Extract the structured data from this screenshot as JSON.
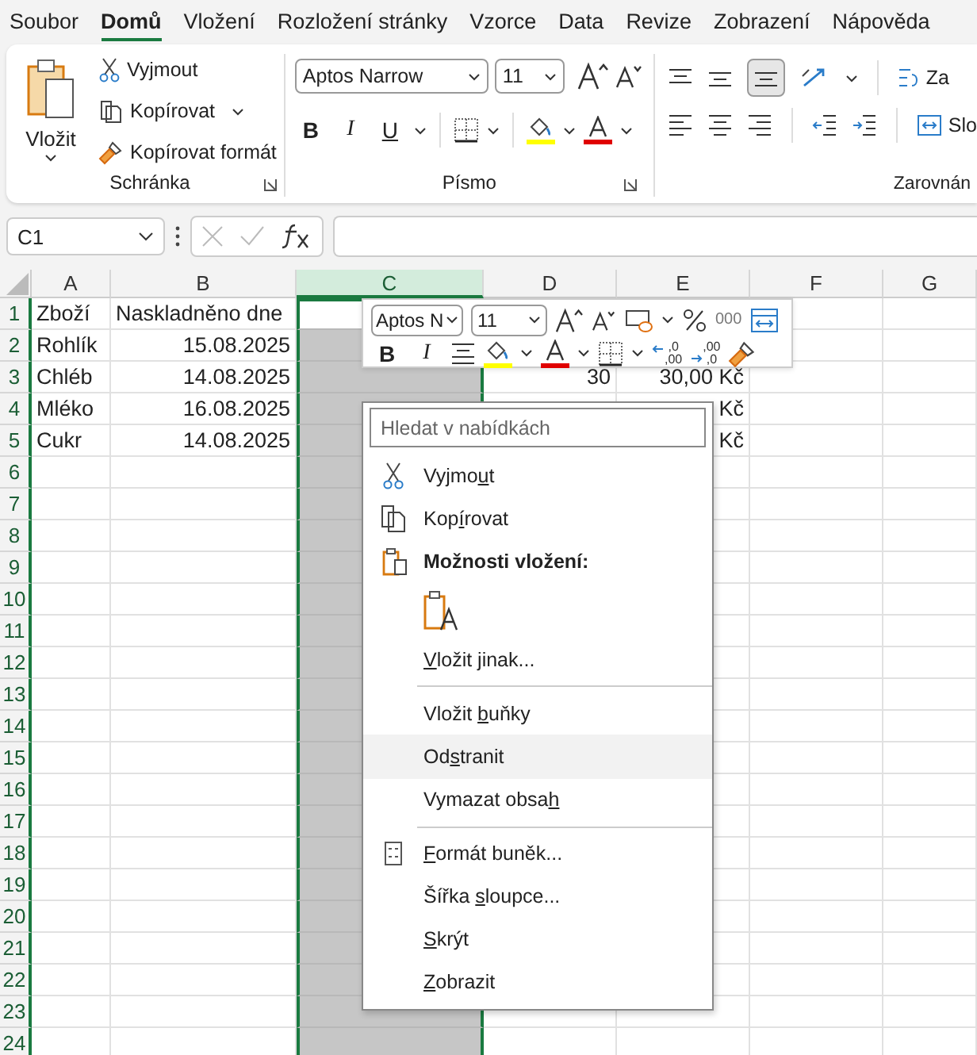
{
  "menu_tabs": [
    {
      "label": "Soubor",
      "selected": false
    },
    {
      "label": "Domů",
      "selected": true
    },
    {
      "label": "Vložení",
      "selected": false
    },
    {
      "label": "Rozložení stránky",
      "selected": false
    },
    {
      "label": "Vzorce",
      "selected": false
    },
    {
      "label": "Data",
      "selected": false
    },
    {
      "label": "Revize",
      "selected": false
    },
    {
      "label": "Zobrazení",
      "selected": false
    },
    {
      "label": "Nápověda",
      "selected": false
    }
  ],
  "ribbon": {
    "clipboard": {
      "paste": "Vložit",
      "cut": "Vyjmout",
      "copy": "Kopírovat",
      "format_painter": "Kopírovat formát",
      "label": "Schránka"
    },
    "font": {
      "name": "Aptos Narrow",
      "size": "11",
      "bold": "B",
      "italic": "I",
      "underline": "U",
      "label": "Písmo"
    },
    "alignment": {
      "label": "Zarovnán",
      "wrap": "Za",
      "merge": "Slo"
    }
  },
  "formula_bar": {
    "name_box": "C1"
  },
  "sheet": {
    "columns": [
      {
        "label": "A",
        "selected": false
      },
      {
        "label": "B",
        "selected": false
      },
      {
        "label": "C",
        "selected": true
      },
      {
        "label": "D",
        "selected": false
      },
      {
        "label": "E",
        "selected": false
      },
      {
        "label": "F",
        "selected": false
      },
      {
        "label": "G",
        "selected": false
      }
    ],
    "rows": [
      {
        "header": "1",
        "cells": {
          "A": {
            "text": "Zboží"
          },
          "B": {
            "text": "Naskladněno dne"
          }
        }
      },
      {
        "header": "2",
        "cells": {
          "A": {
            "text": "Rohlík"
          },
          "B": {
            "text": "15.08.2025",
            "right_aligned": true
          }
        }
      },
      {
        "header": "3",
        "cells": {
          "A": {
            "text": "Chléb"
          },
          "B": {
            "text": "14.08.2025",
            "right_aligned": true
          },
          "D": {
            "text": "30",
            "right_aligned": true
          },
          "E": {
            "text": "30,00 Kč",
            "right_aligned": true
          }
        }
      },
      {
        "header": "4",
        "cells": {
          "A": {
            "text": "Mléko"
          },
          "B": {
            "text": "16.08.2025",
            "right_aligned": true
          },
          "E": {
            "text": "Kč",
            "right_aligned": true
          }
        }
      },
      {
        "header": "5",
        "cells": {
          "A": {
            "text": "Cukr"
          },
          "B": {
            "text": "14.08.2025",
            "right_aligned": true
          },
          "E": {
            "text": "Kč",
            "right_aligned": true
          }
        }
      },
      {
        "header": "6",
        "cells": {}
      },
      {
        "header": "7",
        "cells": {}
      },
      {
        "header": "8",
        "cells": {}
      },
      {
        "header": "9",
        "cells": {}
      },
      {
        "header": "10",
        "cells": {}
      },
      {
        "header": "11",
        "cells": {}
      },
      {
        "header": "12",
        "cells": {}
      },
      {
        "header": "13",
        "cells": {}
      },
      {
        "header": "14",
        "cells": {}
      },
      {
        "header": "15",
        "cells": {}
      },
      {
        "header": "16",
        "cells": {}
      },
      {
        "header": "17",
        "cells": {}
      },
      {
        "header": "18",
        "cells": {}
      },
      {
        "header": "19",
        "cells": {}
      },
      {
        "header": "20",
        "cells": {}
      },
      {
        "header": "21",
        "cells": {}
      },
      {
        "header": "22",
        "cells": {}
      },
      {
        "header": "23",
        "cells": {}
      },
      {
        "header": "24",
        "cells": {}
      }
    ]
  },
  "mini_toolbar": {
    "font": "Aptos N",
    "size": "11",
    "thousands": "000",
    "bold": "B",
    "italic": "I",
    "decimals": [
      {
        "top": ",0",
        "bottom": ",00"
      },
      {
        "top": ",00",
        "bottom": ",0"
      }
    ]
  },
  "context_menu": {
    "search": {
      "placeholder": "Hledat v nabídkách"
    },
    "items": [
      {
        "kind": "item",
        "before": "Vyjmo",
        "key": "u",
        "after": "t",
        "selected": false
      },
      {
        "kind": "item",
        "before": "Kop",
        "key": "í",
        "after": "rovat",
        "selected": false
      },
      {
        "kind": "header",
        "label": "Možnosti vložení:"
      },
      {
        "kind": "paste_options"
      },
      {
        "kind": "item",
        "key": "V",
        "after": "ložit jinak...",
        "selected": false
      },
      {
        "kind": "separator"
      },
      {
        "kind": "item",
        "before": "Vložit ",
        "key": "b",
        "after": "uňky",
        "selected": false
      },
      {
        "kind": "item",
        "before": "Od",
        "key": "s",
        "after": "tranit",
        "selected": true
      },
      {
        "kind": "item",
        "before": "Vymazat obsa",
        "key": "h",
        "selected": false
      },
      {
        "kind": "separator"
      },
      {
        "kind": "item",
        "key": "F",
        "after": "ormát buněk...",
        "selected": false
      },
      {
        "kind": "item",
        "before": "Šířka ",
        "key": "s",
        "after": "loupce...",
        "selected": false
      },
      {
        "kind": "item",
        "key": "S",
        "after": "krýt",
        "selected": false
      },
      {
        "kind": "item",
        "key": "Z",
        "after": "obrazit",
        "selected": false
      }
    ]
  }
}
